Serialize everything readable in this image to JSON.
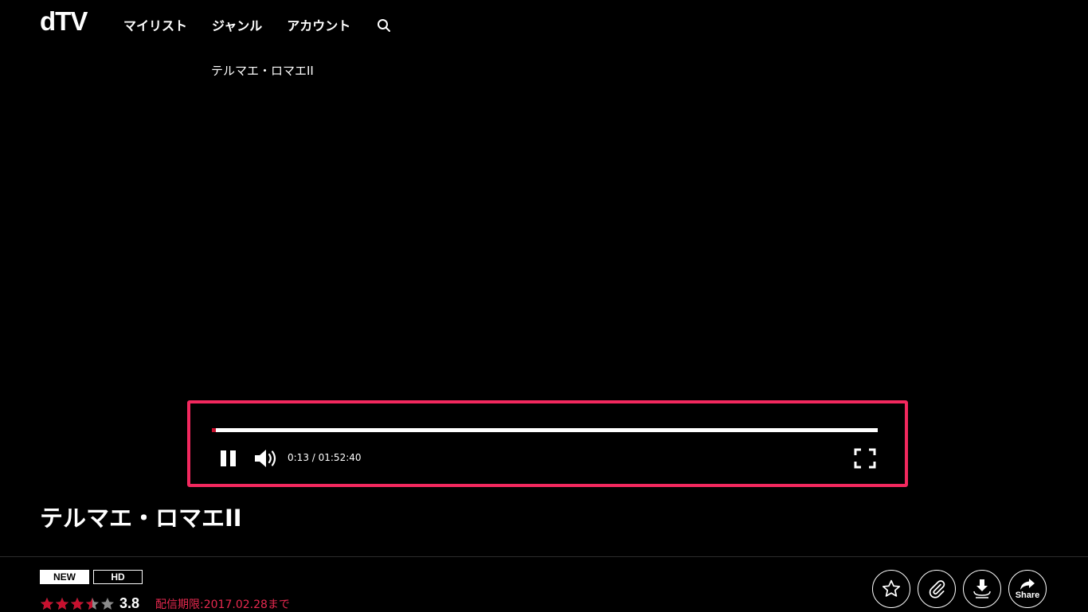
{
  "brand": {
    "logo": "dTV"
  },
  "nav": {
    "items": [
      "マイリスト",
      "ジャンル",
      "アカウント"
    ],
    "search_icon": "search-icon"
  },
  "player": {
    "overlay_title": "テルマエ・ロマエII",
    "progress_fraction": 0.002,
    "time_display": "0:13 / 01:52:40",
    "controls": {
      "pause_icon": "pause-icon",
      "volume_icon": "volume-icon",
      "fullscreen_icon": "fullscreen-icon"
    },
    "highlight_color": "#f2285e",
    "progress_color": "#c8102e"
  },
  "content": {
    "title": "テルマエ・ロマエII",
    "badges": {
      "new": "NEW",
      "hd": "HD"
    },
    "rating": {
      "stars_filled": 3.5,
      "stars_total": 5,
      "value": "3.8"
    },
    "expiry": "配信期限:2017.02.28まで",
    "actions": {
      "share_label": "Share"
    }
  },
  "colors": {
    "accent": "#e8294f",
    "star_filled": "#c8102e",
    "star_empty": "#8a8a8a"
  }
}
